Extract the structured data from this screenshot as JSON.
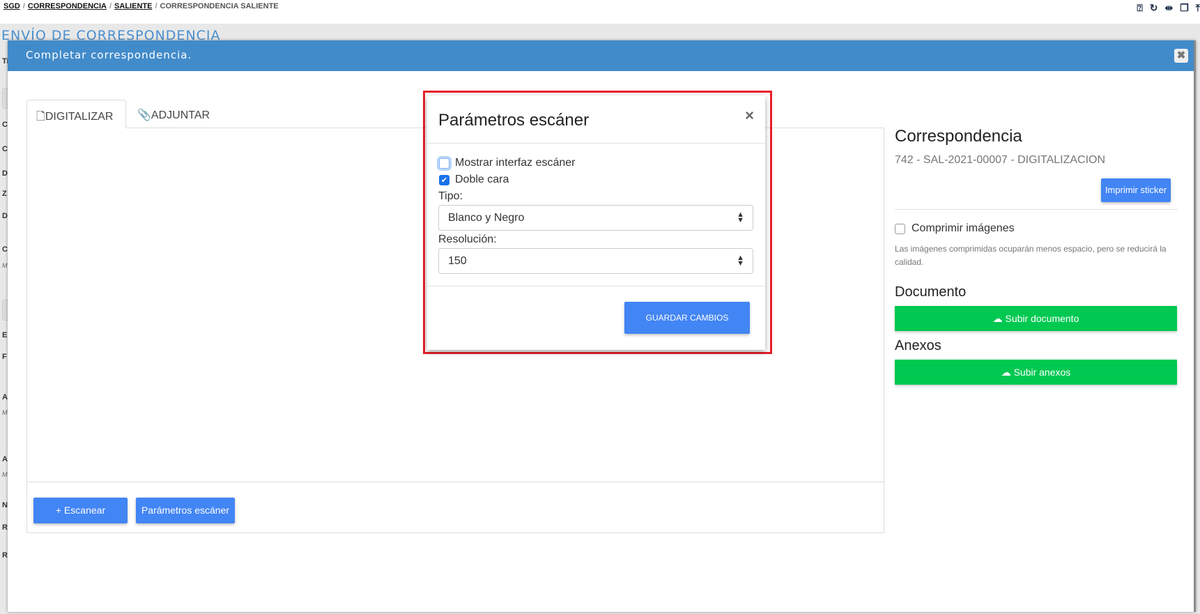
{
  "breadcrumb": {
    "items": [
      "SGD",
      "CORRESPONDENCIA",
      "SALIENTE"
    ],
    "current": "CORRESPONDENCIA SALIENTE"
  },
  "top_icons": [
    "help-icon",
    "refresh-icon",
    "split-icon",
    "restore-window-icon",
    "scroll-top-icon"
  ],
  "page_title": "ENVÍO DE CORRESPONDENCIA",
  "side_letters": [
    "Ti",
    "C",
    "C",
    "D",
    "Z",
    "D",
    "C",
    "M",
    "E",
    "F",
    "A",
    "M",
    "A",
    "M",
    "N",
    "R",
    "R"
  ],
  "modal": {
    "title": "Completar correspondencia.",
    "close": "✖",
    "header_color": "#428bca",
    "tabs": [
      {
        "label": "DIGITALIZAR",
        "icon": "file-icon",
        "active": true
      },
      {
        "label": "ADJUNTAR",
        "icon": "paperclip-icon",
        "active": false
      }
    ],
    "scan_button": "+ Escanear",
    "params_button": "Parámetros escáner",
    "right": {
      "title": "Correspondencia",
      "subtitle": "742 - SAL-2021-00007 - DIGITALIZACION",
      "sticker_button": "Imprimir sticker",
      "compress_label": "Comprimir imágenes",
      "compress_checked": false,
      "help": "Las imágenes comprimidas ocuparán menos espacio, pero se reducirá la calidad.",
      "document_heading": "Documento",
      "upload_document": "Subir documento",
      "annex_heading": "Anexos",
      "upload_annex": "Subir anexos",
      "upload_color": "#00c851"
    }
  },
  "scanner_dialog": {
    "title": "Parámetros escáner",
    "close": "×",
    "show_interface": {
      "label": "Mostrar interfaz escáner",
      "checked": false
    },
    "duplex": {
      "label": "Doble cara",
      "checked": true
    },
    "type_label": "Tipo:",
    "type_value": "Blanco y Negro",
    "resolution_label": "Resolución:",
    "resolution_value": "150",
    "save_button": "GUARDAR CAMBIOS",
    "highlight_color": "#e8202a"
  }
}
